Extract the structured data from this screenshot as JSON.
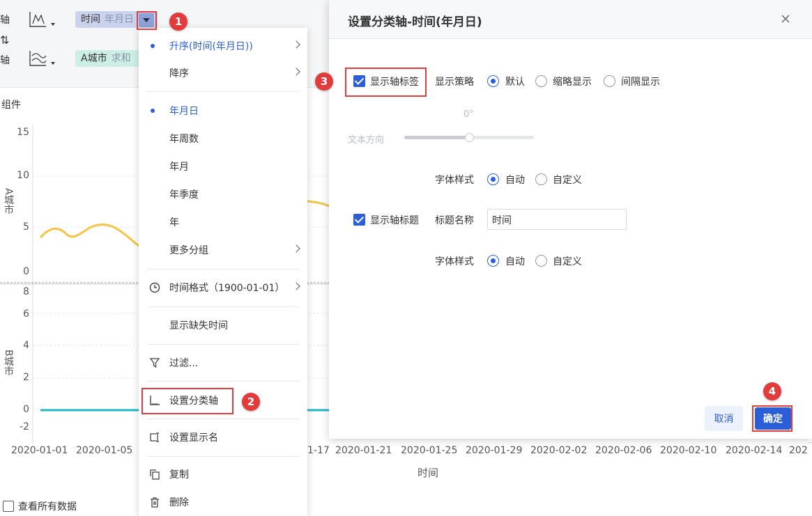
{
  "shelf": {
    "x_axis_label": "横轴",
    "y_axis_label": "纵轴",
    "swap_glyph": "⇅",
    "time_pill": {
      "name": "时间",
      "sub": "年月日"
    },
    "city_pill": {
      "name": "A城市",
      "sub": "求和"
    },
    "component_tab": "组件"
  },
  "chart": {
    "top_axis_title": "A城市",
    "bottom_axis_title": "B城市",
    "top_ticks": [
      "15",
      "10",
      "5",
      "0"
    ],
    "bottom_ticks": [
      "8",
      "6",
      "4",
      "2",
      "0",
      "-2"
    ],
    "x_ticks": [
      "2020-01-01",
      "2020-01-05",
      "1-17",
      "2020-01-21",
      "2020-01-25",
      "2020-01-29",
      "2020-02-02",
      "2020-02-06",
      "2020-02-10",
      "2020-02-14",
      "202"
    ],
    "x_axis_title": "时间",
    "line_color_a": "#f5c445",
    "line_color_b": "#1bb8c9",
    "view_all_label": "查看所有数据"
  },
  "menu": {
    "items": [
      {
        "label": "升序(时间(年月日))",
        "active": true,
        "submenu": true
      },
      {
        "label": "降序",
        "active": false,
        "submenu": true
      },
      {
        "label": "年月日",
        "active": true,
        "submenu": false
      },
      {
        "label": "年周数",
        "active": false,
        "submenu": false
      },
      {
        "label": "年月",
        "active": false,
        "submenu": false
      },
      {
        "label": "年季度",
        "active": false,
        "submenu": false
      },
      {
        "label": "年",
        "active": false,
        "submenu": false
      },
      {
        "label": "更多分组",
        "active": false,
        "submenu": true
      },
      {
        "label": "时间格式（1900-01-01）",
        "icon": "clock-icon",
        "submenu": true
      },
      {
        "label": "显示缺失时间"
      },
      {
        "label": "过滤...",
        "icon": "filter-icon"
      },
      {
        "label": "设置分类轴",
        "icon": "axis-icon"
      },
      {
        "label": "设置显示名",
        "icon": "rename-icon"
      },
      {
        "label": "复制",
        "icon": "copy-icon"
      },
      {
        "label": "删除",
        "icon": "trash-icon"
      }
    ]
  },
  "dialog": {
    "title": "设置分类轴-时间(年月日)",
    "show_axis_labels": "显示轴标签",
    "display_strategy": "显示策略",
    "strategy_options": [
      "默认",
      "缩略显示",
      "间隔显示"
    ],
    "angle_value": "0°",
    "text_direction": "文本方向",
    "slider_level": 0.5,
    "font_style_label": "字体样式",
    "font_style_options": [
      "自动",
      "自定义"
    ],
    "show_axis_title": "显示轴标题",
    "title_name_label": "标题名称",
    "title_name_value": "时间",
    "cancel_label": "取消",
    "ok_label": "确定"
  },
  "annotations": [
    "1",
    "2",
    "3",
    "4"
  ],
  "colors": {
    "accent": "#2b5fd9",
    "highlight": "#e23b3b"
  }
}
